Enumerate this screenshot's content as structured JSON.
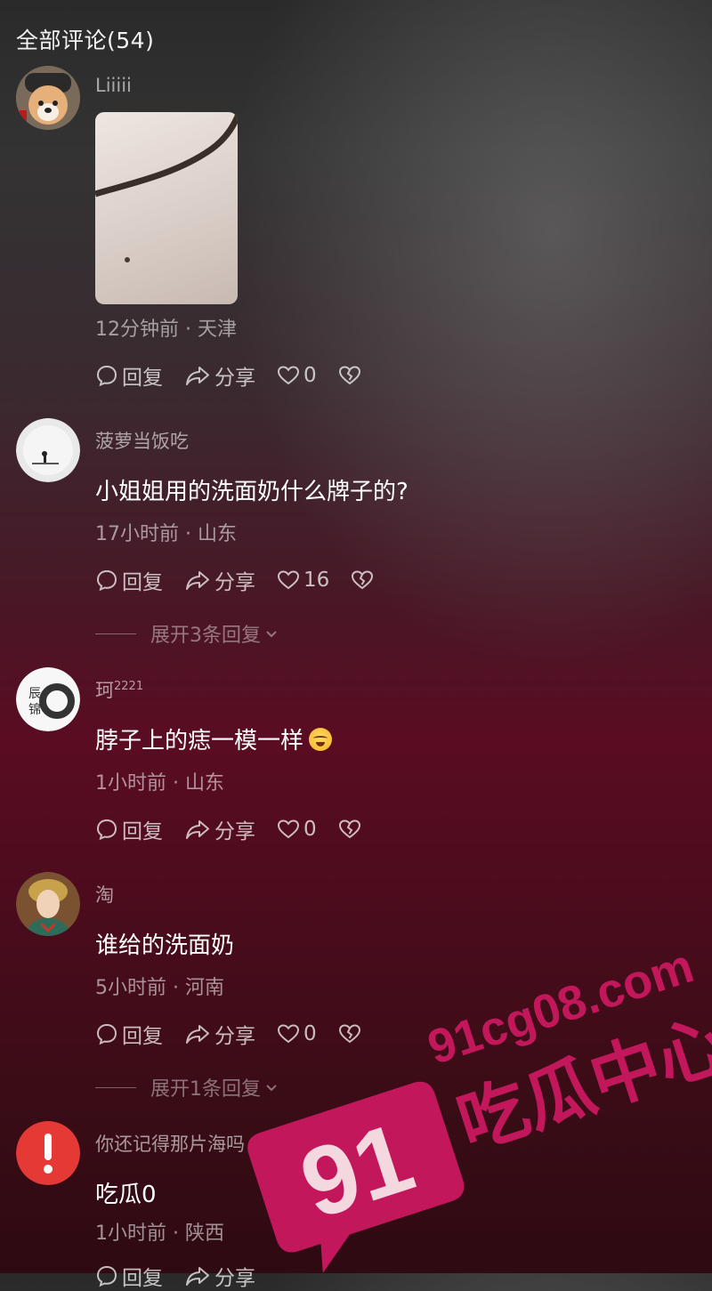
{
  "header": {
    "title": "全部评论(54)"
  },
  "actions_labels": {
    "reply": "回复",
    "share": "分享"
  },
  "comments": [
    {
      "username": "Liiiii",
      "text": "",
      "meta": "12分钟前 · 天津",
      "likes": "0",
      "has_image": true
    },
    {
      "username": "菠萝当饭吃",
      "text": "小姐姐用的洗面奶什么牌子的?",
      "meta": "17小时前 · 山东",
      "likes": "16",
      "expand": "展开3条回复"
    },
    {
      "username": "珂",
      "username_sup": "2221",
      "text": "脖子上的痣一模一样",
      "meta": "1小时前 · 山东",
      "likes": "0"
    },
    {
      "username": "淘",
      "text": "谁给的洗面奶",
      "meta": "5小时前 · 河南",
      "likes": "0",
      "expand": "展开1条回复"
    },
    {
      "username": "你还记得那片海吗",
      "text": "吃瓜0",
      "meta": "1小时前 · 陕西",
      "likes": "",
      "partial_actions": "回复 分享"
    }
  ],
  "watermark": {
    "number": "91",
    "domain": "91cg08.com",
    "brand": "吃瓜中心",
    "color": "#c2185b"
  },
  "colors": {
    "accent_red": "#e53935",
    "bg_top": "#2a2a2a",
    "bg_bottom": "#3a0c16"
  }
}
